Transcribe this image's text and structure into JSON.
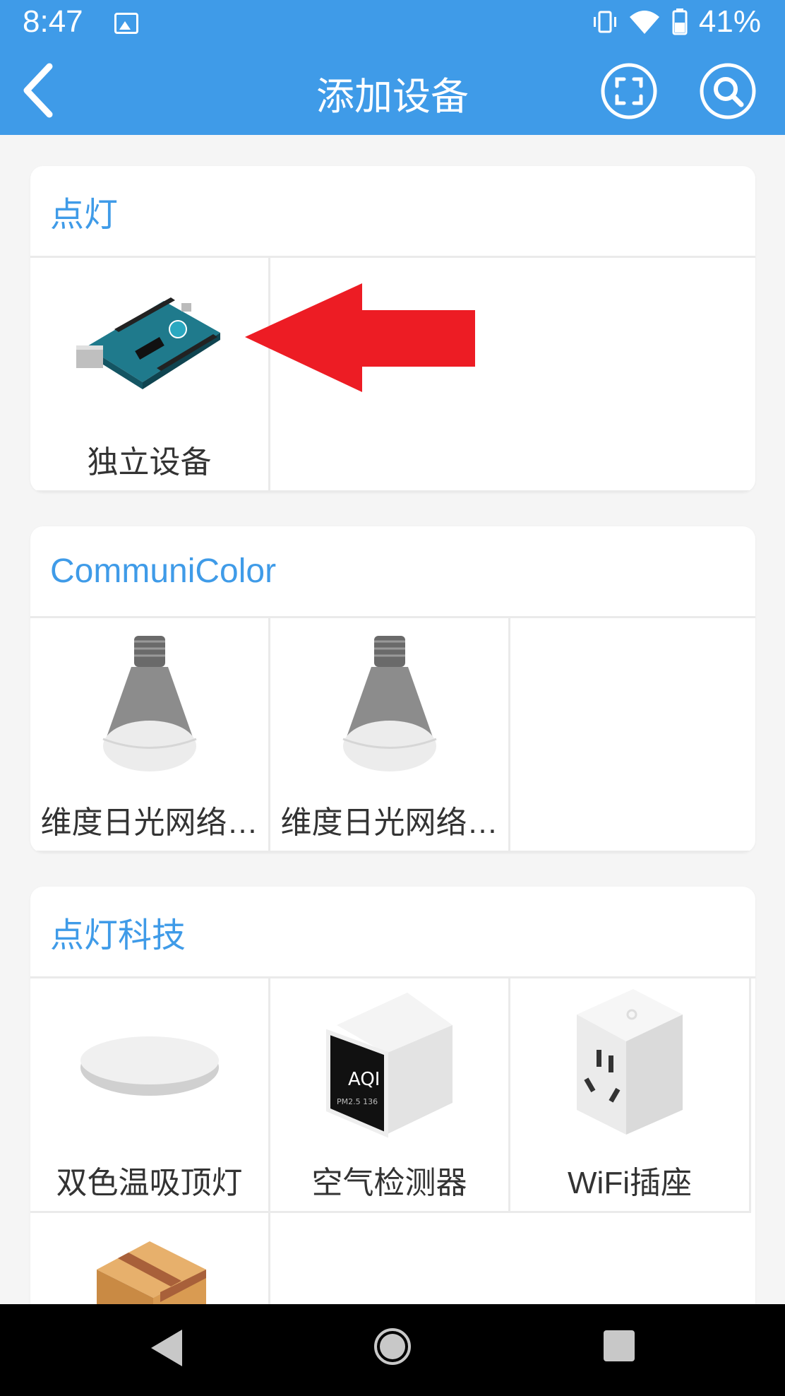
{
  "status": {
    "time": "8:47",
    "battery": "41%"
  },
  "header": {
    "title": "添加设备"
  },
  "sections": [
    {
      "title": "点灯",
      "items": [
        {
          "label": "独立设备"
        }
      ]
    },
    {
      "title": "CommuniColor",
      "items": [
        {
          "label": "维度日光网络…"
        },
        {
          "label": "维度日光网络…"
        }
      ]
    },
    {
      "title": "点灯科技",
      "items": [
        {
          "label": "双色温吸顶灯"
        },
        {
          "label": "空气检测器"
        },
        {
          "label": "WiFi插座"
        }
      ]
    }
  ],
  "aqi": {
    "brand": "AQI",
    "line": "PM2.5 136"
  },
  "colors": {
    "accent": "#3f9be8",
    "arrow": "#ed1c24"
  }
}
